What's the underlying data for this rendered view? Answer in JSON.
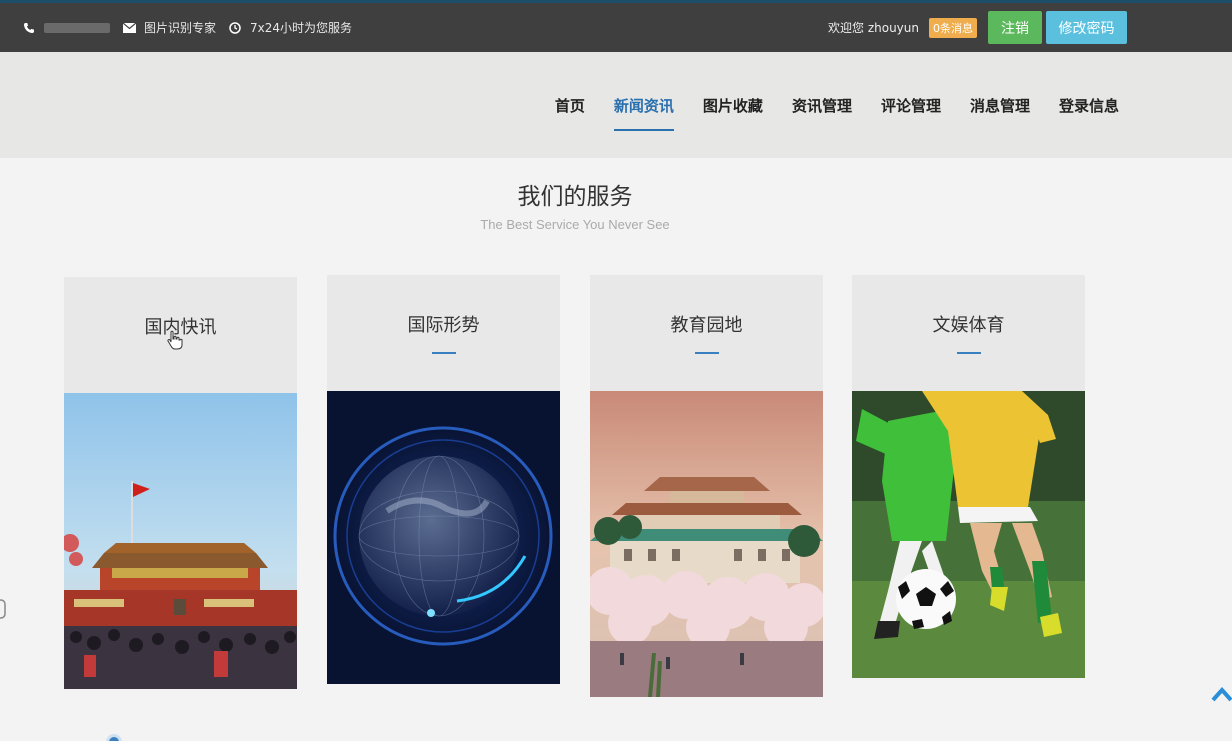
{
  "topbar": {
    "phone_icon": "phone-icon",
    "mail_icon": "mail-icon",
    "clock_icon": "clock-icon",
    "site_name": "图片识别专家",
    "service_hours": "7x24小时为您服务",
    "welcome": "欢迎您 zhouyun",
    "messages_badge": "0条消息",
    "logout_label": "注销",
    "change_password_label": "修改密码"
  },
  "nav": {
    "items": [
      {
        "label": "首页",
        "active": false
      },
      {
        "label": "新闻资讯",
        "active": true
      },
      {
        "label": "图片收藏",
        "active": false
      },
      {
        "label": "资讯管理",
        "active": false
      },
      {
        "label": "评论管理",
        "active": false
      },
      {
        "label": "消息管理",
        "active": false
      },
      {
        "label": "登录信息",
        "active": false
      }
    ]
  },
  "services": {
    "title": "我们的服务",
    "subtitle": "The Best Service You Never See",
    "cards": [
      {
        "title": "国内快讯",
        "image": "tiananmen-photo"
      },
      {
        "title": "国际形势",
        "image": "digital-globe-photo"
      },
      {
        "title": "教育园地",
        "image": "campus-blossom-photo"
      },
      {
        "title": "文娱体育",
        "image": "kids-soccer-photo"
      }
    ]
  },
  "colors": {
    "topbar_bg": "#3f3f3f",
    "nav_bg": "#e7e7e6",
    "accent_blue": "#2a6fae",
    "badge_orange": "#f0ad4e",
    "logout_green": "#5cb85c",
    "password_blue": "#5bc0de"
  }
}
